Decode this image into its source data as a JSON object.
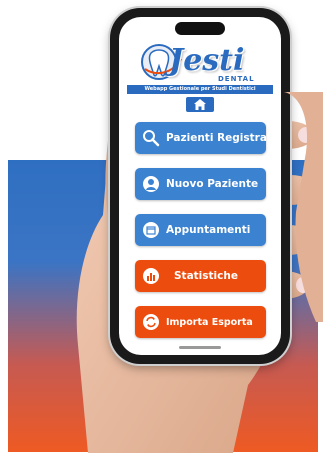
{
  "app": {
    "logo_title": "Jesti",
    "logo_subtitle": "DENTAL",
    "tagline": "Webapp Gestionale per Studi Dentistici"
  },
  "nav": {
    "home_icon": "home-icon"
  },
  "menu": [
    {
      "label": "Pazienti Registrati",
      "icon": "search-icon",
      "color": "#3b82d0"
    },
    {
      "label": "Nuovo Paziente",
      "icon": "patient-icon",
      "color": "#3b82d0"
    },
    {
      "label": "Appuntamenti",
      "icon": "calendar-icon",
      "color": "#3b82d0"
    },
    {
      "label": "Statistiche",
      "icon": "chart-icon",
      "color": "#ec4d0f"
    },
    {
      "label": "Importa Esporta",
      "icon": "sync-icon",
      "color": "#ec4d0f"
    }
  ],
  "colors": {
    "brand_blue": "#2b6bbf",
    "button_blue": "#3b82d0",
    "button_orange": "#ec4d0f"
  }
}
